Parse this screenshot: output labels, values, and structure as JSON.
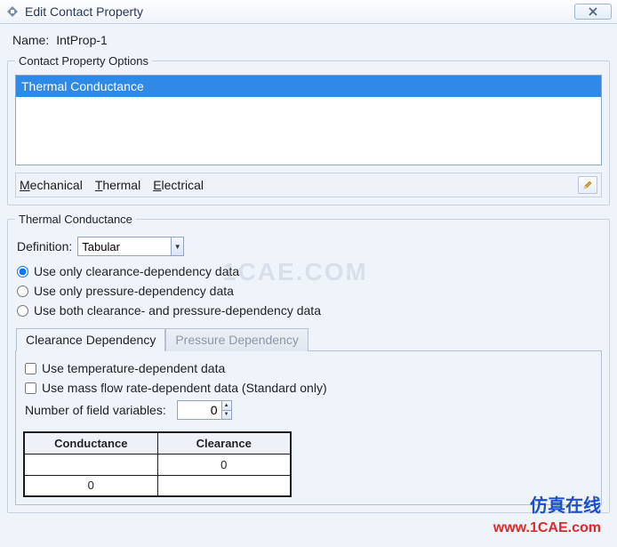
{
  "window": {
    "title": "Edit Contact Property"
  },
  "name_label": "Name:",
  "name_value": "IntProp-1",
  "options_group": {
    "legend": "Contact Property Options",
    "items": [
      "Thermal Conductance"
    ],
    "categories": {
      "mechanical": "Mechanical",
      "thermal": "Thermal",
      "electrical": "Electrical"
    }
  },
  "thermal_group": {
    "legend": "Thermal Conductance",
    "definition_label": "Definition:",
    "definition_value": "Tabular",
    "radios": {
      "clearance": "Use only clearance-dependency data",
      "pressure": "Use only pressure-dependency data",
      "both": "Use both clearance- and pressure-dependency data"
    },
    "tabs": {
      "clearance": "Clearance Dependency",
      "pressure": "Pressure Dependency"
    },
    "checks": {
      "temp": "Use temperature-dependent data",
      "massflow": "Use mass flow rate-dependent data (Standard only)"
    },
    "field_vars_label": "Number of field variables:",
    "field_vars_value": "0",
    "table": {
      "headers": [
        "Conductance",
        "Clearance"
      ],
      "rows": [
        [
          "",
          "0"
        ],
        [
          "0",
          ""
        ]
      ]
    }
  },
  "watermarks": {
    "center": "1CAE.COM",
    "brand_cn": "仿真在线",
    "brand_url": "www.1CAE.com"
  }
}
